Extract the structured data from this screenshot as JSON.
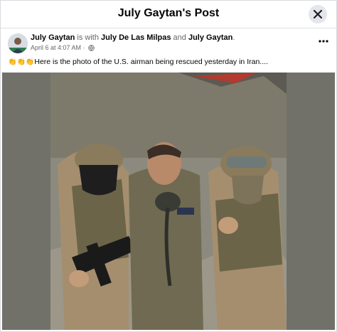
{
  "header": {
    "title": "July Gaytan's Post"
  },
  "post": {
    "author": "July Gaytan",
    "with_text": "is with",
    "tagged_1": "July De Las Milpas",
    "and_text": "and",
    "tagged_2": "July Gaytan",
    "date": "April 6 at 4:07 AM",
    "dot": "·",
    "clap_emojis": "👏👏👏",
    "caption": "Here is the photo of the U.S. airman being rescued yesterday in Iran...."
  },
  "icons": {
    "close": "close-icon",
    "globe": "globe-icon",
    "more": "more-options-icon"
  },
  "colors": {
    "text": "#050505",
    "muted": "#65676b",
    "photo_bg": "#71716a",
    "uniform": "#6f6a51",
    "camo": "#a58e6e"
  }
}
